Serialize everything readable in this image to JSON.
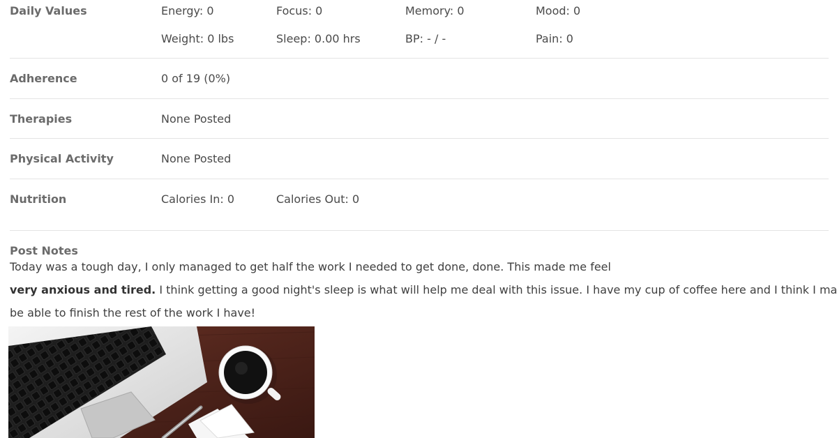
{
  "daily_values": {
    "label": "Daily Values",
    "energy": "Energy: 0",
    "focus": "Focus: 0",
    "memory": "Memory: 0",
    "mood": "Mood: 0",
    "weight": "Weight: 0 lbs",
    "sleep": "Sleep: 0.00 hrs",
    "bp": "BP: - / -",
    "pain": "Pain: 0"
  },
  "adherence": {
    "label": "Adherence",
    "value": "0 of 19 (0%)"
  },
  "therapies": {
    "label": "Therapies",
    "value": "None Posted"
  },
  "physical_activity": {
    "label": "Physical Activity",
    "value": "None Posted"
  },
  "nutrition": {
    "label": "Nutrition",
    "calories_in": "Calories In: 0",
    "calories_out": "Calories Out: 0"
  },
  "post_notes": {
    "title": "Post Notes",
    "line1": "Today was a tough day, I only managed to get half the work I needed to get done, done. This made me feel",
    "line2_bold": "very anxious and tired.",
    "line2_rest": " I think getting a good night's sleep is what will help me deal with this issue. I have my cup of coffee here and I think I may",
    "line3": "be able to finish the rest of the work I have!",
    "image_icon": "laptop-and-coffee-photo"
  },
  "colors": {
    "label": "#6b6b6b",
    "text": "#4a4a4a",
    "divider": "#e4e4e4",
    "desk": "#5a2a20"
  }
}
